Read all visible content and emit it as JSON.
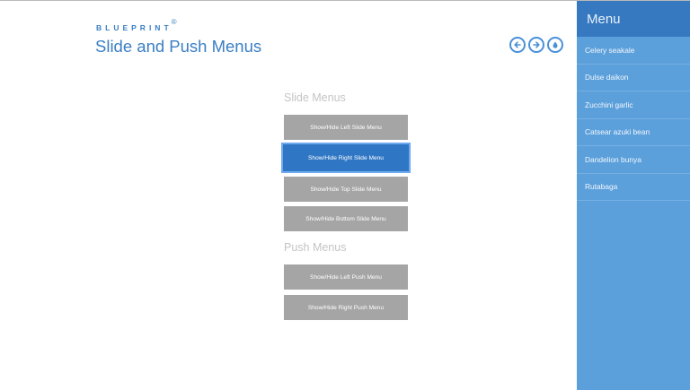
{
  "header": {
    "brand": "BLUEPRINT",
    "brand_mark": "®",
    "title": "Slide and Push Menus"
  },
  "nav": {
    "prev_icon": "arrow-left-icon",
    "next_icon": "arrow-right-icon",
    "download_icon": "drop-icon",
    "accent_color": "#4a90d9"
  },
  "slide_section": {
    "label": "Slide Menus",
    "buttons": [
      {
        "label": "Show/Hide Left Slide Menu",
        "active": false
      },
      {
        "label": "Show/Hide Right Slide Menu",
        "active": true
      },
      {
        "label": "Show/Hide Top Slide Menu",
        "active": false
      },
      {
        "label": "Show/Hide Bottom Slide Menu",
        "active": false
      }
    ]
  },
  "push_section": {
    "label": "Push Menus",
    "buttons": [
      {
        "label": "Show/Hide Left Push Menu"
      },
      {
        "label": "Show/Hide Right Push Menu"
      }
    ]
  },
  "side_menu": {
    "title": "Menu",
    "items": [
      {
        "label": "Celery seakale"
      },
      {
        "label": "Dulse daikon"
      },
      {
        "label": "Zucchini garlic"
      },
      {
        "label": "Catsear azuki bean"
      },
      {
        "label": "Dandelion bunya"
      },
      {
        "label": "Rutabaga"
      }
    ],
    "colors": {
      "panel": "#5b9fdb",
      "header": "#3679c0"
    }
  },
  "colors": {
    "button_gray": "#a5a5a5",
    "button_active": "#2f77c4",
    "brand_blue": "#3a7fc4"
  }
}
